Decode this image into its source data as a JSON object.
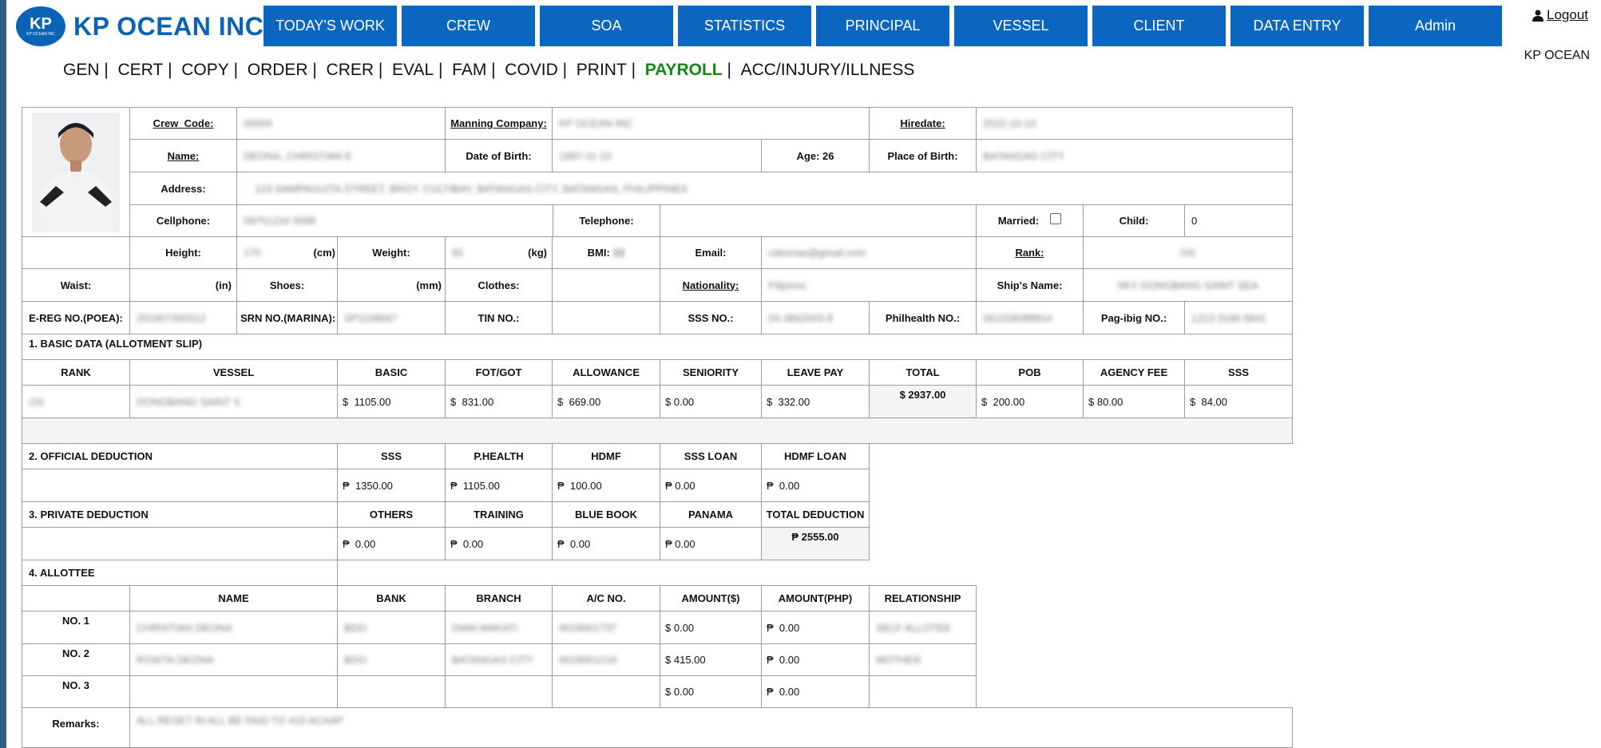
{
  "brand": {
    "logo_kp": "KP",
    "logo_sub": "KP OCEAN INC",
    "name": "KP OCEAN INC",
    "company": "KP OCEAN",
    "logout": "Logout"
  },
  "topnav": [
    "TODAY'S WORK",
    "CREW",
    "SOA",
    "STATISTICS",
    "PRINCIPAL",
    "VESSEL",
    "CLIENT",
    "DATA ENTRY",
    "Admin"
  ],
  "subnav": [
    "GEN",
    "CERT",
    "COPY",
    "ORDER",
    "CRER",
    "EVAL",
    "FAM",
    "COVID",
    "PRINT",
    "PAYROLL",
    "ACC/INJURY/ILLNESS"
  ],
  "subnav_active": "PAYROLL",
  "profile": {
    "crew_code_label": "Crew_Code:",
    "crew_code": "00000",
    "manning_label": "Manning Company:",
    "manning": "KP OCEAN INC",
    "hiredate_label": "Hiredate:",
    "hiredate": "2022-10-10",
    "name_label": "Name:",
    "name": "DEONA, CHRISTIAN E",
    "dob_label": "Date of Birth:",
    "dob": "1997-11-10",
    "age_label": "Age: 26",
    "pob_label": "Place of Birth:",
    "pob": "BATANGAS CITY",
    "address_label": "Address:",
    "address": "123 SAMPAGUITA STREET, BRGY. CULTIBAY, BATANGAS CITY, BATANGAS, PHILIPPINES",
    "cell_label": "Cellphone:",
    "cell": "09751234 5588",
    "tel_label": "Telephone:",
    "tel": "",
    "married_label": "Married:",
    "child_label": "Child:",
    "child": "0",
    "height_label": "Height:",
    "height": "170",
    "cm": "(cm)",
    "weight_label": "Weight:",
    "weight": "65",
    "kg": "(kg)",
    "bmi_label": "BMI:",
    "bmi": "22",
    "email_label": "Email:",
    "email": "cdeonae@gmail.com",
    "rank_label": "Rank:",
    "rank": "OS",
    "waist_label": "Waist:",
    "in": "(in)",
    "shoes_label": "Shoes:",
    "mm": "(mm)",
    "clothes_label": "Clothes:",
    "nat_label": "Nationality:",
    "nationality": "Filipinos",
    "ship_label": "Ship's Name:",
    "ship": "SKY DONGBANG SAINT SEA",
    "ereg_label": "E-REG NO.(POEA):",
    "ereg": "201907300512",
    "srn_label": "SRN NO.(MARINA):",
    "srn": "SP1108067",
    "tin_label": "TIN NO.:",
    "sss_label": "SSS NO.:",
    "sss": "04-3862043-8",
    "phil_label": "Philhealth NO.:",
    "phil": "061028088814",
    "pagibig_label": "Pag-ibig NO.:",
    "pagibig": "1213 3196 6841"
  },
  "basic": {
    "title": "1. BASIC DATA (ALLOTMENT SLIP)",
    "headers": [
      "RANK",
      "VESSEL",
      "BASIC",
      "FOT/GOT",
      "ALLOWANCE",
      "SENIORITY",
      "LEAVE PAY",
      "TOTAL",
      "POB",
      "AGENCY FEE",
      "SSS"
    ],
    "rank": "OS",
    "vessel": "DONGBANG SAINT S",
    "usd": "$",
    "basic": "1105.00",
    "fot": "831.00",
    "allowance": "669.00",
    "seniority": "0.00",
    "leave": "332.00",
    "total": "$ 2937.00",
    "pob": "200.00",
    "agency": "80.00",
    "sss": "84.00"
  },
  "official": {
    "title": "2. OFFICIAL DEDUCTION",
    "headers": [
      "SSS",
      "P.HEALTH",
      "HDMF",
      "SSS LOAN",
      "HDMF LOAN"
    ],
    "peso": "₱",
    "values": [
      "1350.00",
      "1105.00",
      "100.00",
      "0.00",
      "0.00"
    ]
  },
  "private": {
    "title": "3. PRIVATE DEDUCTION",
    "headers": [
      "OTHERS",
      "TRAINING",
      "BLUE BOOK",
      "PANAMA",
      "TOTAL DEDUCTION"
    ],
    "values": [
      "0.00",
      "0.00",
      "0.00",
      "0.00"
    ],
    "total": "₱ 2555.00"
  },
  "allottee": {
    "title": "4. ALLOTTEE",
    "headers": [
      "NAME",
      "BANK",
      "BRANCH",
      "A/C NO.",
      "AMOUNT($)",
      "AMOUNT(PHP)",
      "RELATIONSHIP"
    ],
    "rows": [
      {
        "no": "NO. 1",
        "name": "CHRISTIAN DEONA",
        "bank": "BDO",
        "branch": "DIAN MAKATI",
        "ac": "0018001737",
        "usd": "0.00",
        "php": "0.00",
        "rel": "SELF ALLOTEE"
      },
      {
        "no": "NO. 2",
        "name": "ROSITA DEONA",
        "bank": "BDO",
        "branch": "BATANGAS CITY",
        "ac": "0018001218",
        "usd": "415.00",
        "php": "0.00",
        "rel": "MOTHER"
      },
      {
        "no": "NO. 3",
        "name": "",
        "bank": "",
        "branch": "",
        "ac": "",
        "usd": "0.00",
        "php": "0.00",
        "rel": ""
      }
    ]
  },
  "remarks": {
    "label": "Remarks:",
    "value": "ALL RESET IN ALL BE PAID TO 415 ACAAP"
  }
}
